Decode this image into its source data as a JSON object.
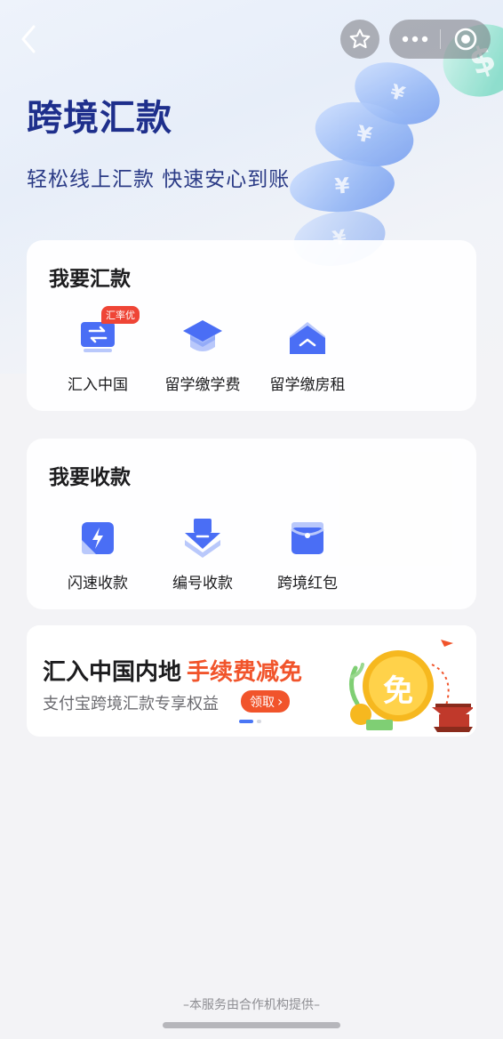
{
  "header": {
    "title": "跨境汇款",
    "subtitle": "轻松线上汇款 快速安心到账"
  },
  "nav": {
    "back_icon": "chevron-left-icon",
    "favorite_icon": "star-icon",
    "more_icon": "more-dots-icon",
    "close_icon": "target-close-icon"
  },
  "send_section": {
    "title": "我要汇款",
    "items": [
      {
        "label": "汇入中国",
        "badge": "汇率优",
        "icon": "transfer-card-icon"
      },
      {
        "label": "留学缴学费",
        "icon": "graduation-cap-icon"
      },
      {
        "label": "留学缴房租",
        "icon": "house-icon"
      }
    ]
  },
  "receive_section": {
    "title": "我要收款",
    "items": [
      {
        "label": "闪速收款",
        "icon": "flash-icon"
      },
      {
        "label": "编号收款",
        "icon": "download-stack-icon"
      },
      {
        "label": "跨境红包",
        "icon": "red-packet-icon"
      }
    ]
  },
  "banner": {
    "headline": "汇入中国内地",
    "headline_highlight": "手续费减免",
    "subtext": "支付宝跨境汇款专享权益",
    "cta": "领取",
    "cta_arrow": "›",
    "coin_text": "免",
    "page_count": 2,
    "active_page": 1
  },
  "footer": {
    "note": "–本服务由合作机构提供–"
  },
  "colors": {
    "title": "#1e2f8c",
    "accent": "#4a76f5",
    "promo": "#f1542b",
    "badge": "#ef4536"
  }
}
